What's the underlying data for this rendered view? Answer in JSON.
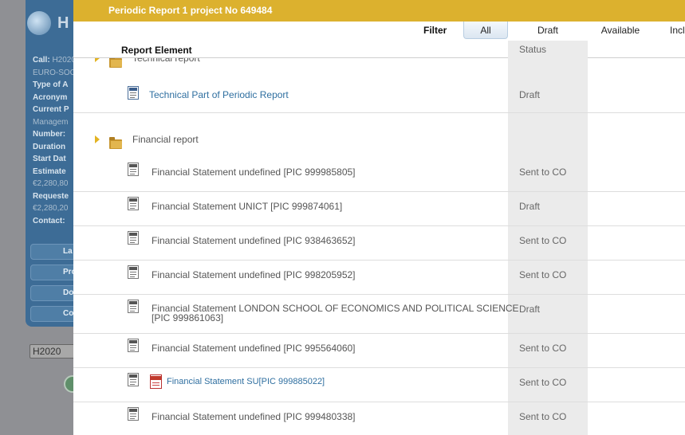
{
  "background": {
    "logo_text": "H",
    "info": [
      {
        "k": "Call:",
        "v": "H2020"
      },
      {
        "k": "",
        "v": "EURO-SOC"
      },
      {
        "k": "Type of A",
        "v": ""
      },
      {
        "k": "Acronym",
        "v": ""
      },
      {
        "k": "Current P",
        "v": ""
      },
      {
        "k": "",
        "v": "Managem"
      },
      {
        "k": "Number:",
        "v": ""
      },
      {
        "k": "Duration",
        "v": ""
      },
      {
        "k": "Start Dat",
        "v": ""
      },
      {
        "k": "Estimate",
        "v": ""
      },
      {
        "k": "",
        "v": "€2,280,80"
      },
      {
        "k": "Requeste",
        "v": ""
      },
      {
        "k": "",
        "v": "€2,280,20"
      },
      {
        "k": "Contact:",
        "v": ""
      }
    ],
    "buttons": [
      "La",
      "Pro",
      "Do",
      "Co"
    ],
    "tag": "H2020"
  },
  "modal": {
    "title": "Periodic Report 1 project No 649484",
    "filter_label": "Filter",
    "tabs": [
      {
        "label": "All",
        "active": true
      },
      {
        "label": "Draft",
        "active": false
      },
      {
        "label": "Available",
        "active": false
      },
      {
        "label": "Incl",
        "active": false
      }
    ],
    "columns": {
      "element": "Report Element",
      "status": "Status"
    },
    "groups": {
      "technical": "Technical report",
      "financial": "Financial report"
    },
    "technical_items": [
      {
        "name": "Technical Part of Periodic Report",
        "status": "Draft"
      }
    ],
    "financial_items": [
      {
        "name": "Financial Statement undefined [PIC 999985805]",
        "status": "Sent to CO"
      },
      {
        "name": "Financial Statement UNICT [PIC 999874061]",
        "status": "Draft"
      },
      {
        "name": "Financial Statement undefined [PIC 938463652]",
        "status": "Sent to CO"
      },
      {
        "name": "Financial Statement undefined [PIC 998205952]",
        "status": "Sent to CO"
      },
      {
        "name_line1": "Financial Statement LONDON SCHOOL OF ECONOMICS AND POLITICAL SCIENCE",
        "name_line2": "[PIC 999861063]",
        "status": "Draft"
      },
      {
        "name": "Financial Statement undefined [PIC 995564060]",
        "status": "Sent to CO"
      },
      {
        "name": "Financial Statement SU[PIC 999885022]",
        "status": "Sent to CO"
      },
      {
        "name": "Financial Statement undefined [PIC 999480338]",
        "status": "Sent to CO"
      }
    ]
  }
}
